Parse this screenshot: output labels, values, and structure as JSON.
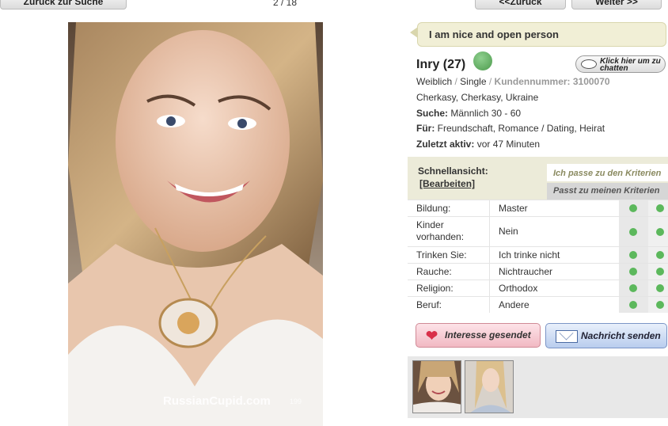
{
  "nav": {
    "back_to_search": "Zurück zur Suche",
    "counter": "2 / 18",
    "prev": "<<Zurück",
    "next": "Weiter >>"
  },
  "photo": {
    "watermark": "RussianCupid.com",
    "photo_number": "199"
  },
  "profile": {
    "status_message": "I am nice and open person",
    "name_age": "Inry (27)",
    "chat_button": "Klick hier um zu chatten",
    "gender": "Weiblich",
    "relationship": "Single",
    "member_label": "Kundennummer: 3100070",
    "location": "Cherkasy, Cherkasy, Ukraine",
    "seeking_label": "Suche:",
    "seeking_value": "Männlich 30 - 60",
    "for_label": "Für:",
    "for_value": "Freundschaft, Romance / Dating, Heirat",
    "last_active_label": "Zuletzt aktiv:",
    "last_active_value": "vor 47 Minuten"
  },
  "quick_view": {
    "title": "Schnellansicht:",
    "edit": "[Bearbeiten]",
    "criteria_1": "Ich passe zu den Kriterien",
    "criteria_2": "Passt zu meinen Kriterien",
    "rows": [
      {
        "label": "Bildung:",
        "value": "Master"
      },
      {
        "label": "Kinder vorhanden:",
        "value": "Nein"
      },
      {
        "label": "Trinken Sie:",
        "value": "Ich trinke nicht"
      },
      {
        "label": "Rauche:",
        "value": "Nichtraucher"
      },
      {
        "label": "Religion:",
        "value": "Orthodox"
      },
      {
        "label": "Beruf:",
        "value": "Andere"
      }
    ]
  },
  "actions": {
    "interest": "Interesse gesendet",
    "message": "Nachricht senden"
  },
  "colors": {
    "status_bg": "#f1efd6",
    "match_dot": "#5cb85c",
    "interest_accent": "#d9304a",
    "message_accent": "#4a6aa3"
  },
  "icons": [
    "person-icon",
    "chat-bubble-icon",
    "heart-icon",
    "envelope-icon"
  ]
}
